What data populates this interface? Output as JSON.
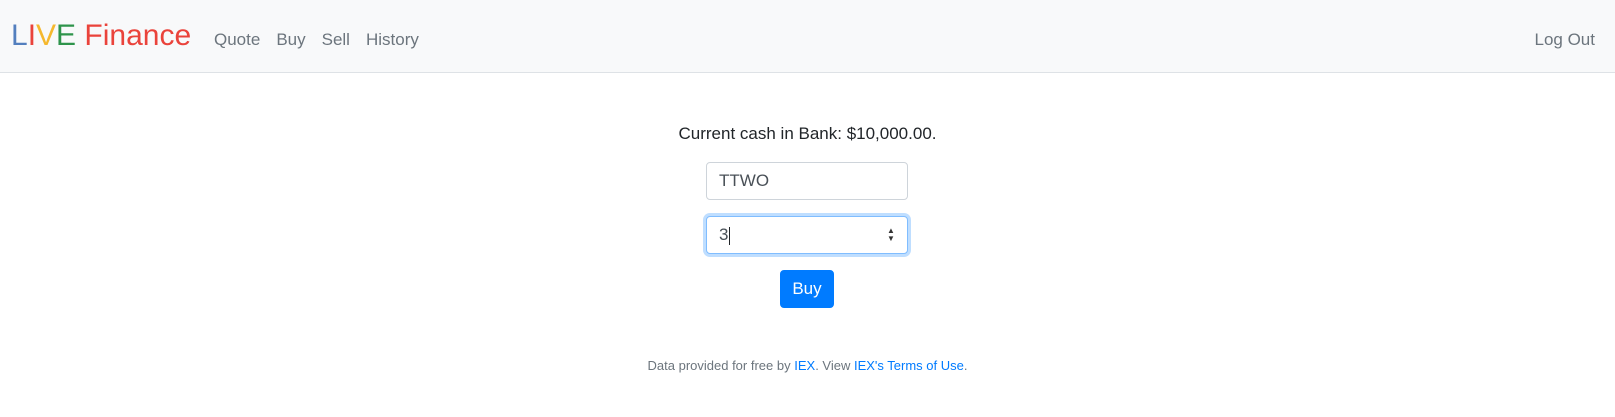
{
  "navbar": {
    "brand_letters": [
      {
        "char": "L",
        "color": "#537fbe"
      },
      {
        "char": "I",
        "color": "#ea433b"
      },
      {
        "char": "V",
        "color": "#f5b82e"
      },
      {
        "char": "E",
        "color": "#2e944b"
      },
      {
        "char": " ",
        "color": "#ea433b"
      },
      {
        "char": "Finance",
        "color": "#ea433b"
      }
    ],
    "links": [
      "Quote",
      "Buy",
      "Sell",
      "History"
    ],
    "logout_label": "Log Out"
  },
  "main": {
    "cash_text": "Current cash in Bank: $10,000.00.",
    "symbol_value": "TTWO",
    "shares_value": "3",
    "buy_label": "Buy"
  },
  "footer": {
    "prefix": "Data provided for free by ",
    "iex_link": "IEX",
    "middle": ". View ",
    "terms_link": "IEX's Terms of Use",
    "suffix": "."
  },
  "colors": {
    "primary": "#007bff",
    "navbar_bg": "#f8f9fa"
  }
}
